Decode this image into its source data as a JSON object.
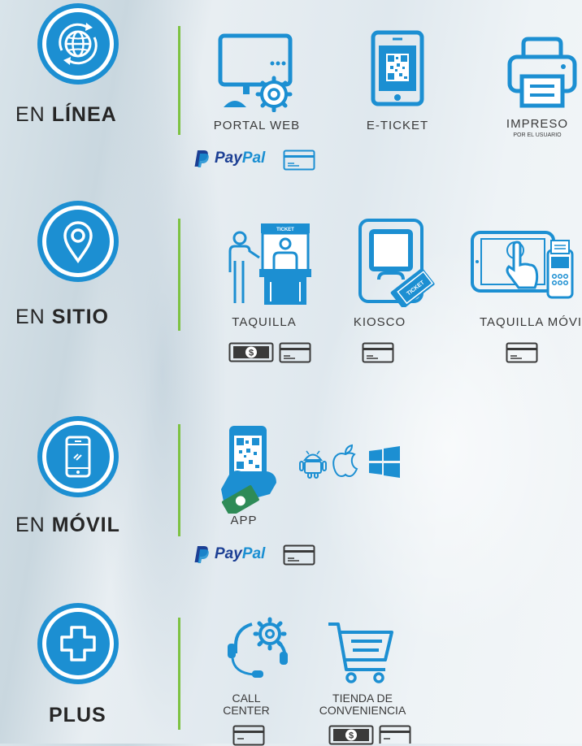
{
  "sections": {
    "online": {
      "prefix": "EN ",
      "emph": "LÍNEA",
      "items": [
        {
          "label": "PORTAL WEB"
        },
        {
          "label": "E-TICKET"
        },
        {
          "label": "IMPRESO",
          "sublabel": "POR EL USUARIO"
        }
      ],
      "payment": {
        "paypal": "PayPal",
        "paypal_a": "Pay",
        "paypal_b": "Pal"
      }
    },
    "onsite": {
      "prefix": "EN ",
      "emph": "SITIO",
      "items": [
        {
          "label": "TAQUILLA"
        },
        {
          "label": "KIOSCO"
        },
        {
          "label": "TAQUILLA  MÓVIL"
        }
      ],
      "booth_sign": "TICKET",
      "ticket_text": "TICKET"
    },
    "mobile": {
      "prefix": "EN ",
      "emph": "MÓVIL",
      "items": [
        {
          "label": "APP"
        }
      ],
      "platforms": [
        "android-icon",
        "apple-icon",
        "windows-icon"
      ],
      "payment": {
        "paypal_a": "Pay",
        "paypal_b": "Pal"
      }
    },
    "plus": {
      "emph": "PLUS",
      "items": [
        {
          "label_line1": "CALL",
          "label_line2": "CENTER"
        },
        {
          "label_line1": "TIENDA DE",
          "label_line2": "CONVENIENCIA"
        }
      ]
    }
  },
  "colors": {
    "blue": "#1c8fd2",
    "green_divider": "#7dc242",
    "paypal_dark": "#1c3f94",
    "paypal_light": "#1a8fd2"
  }
}
